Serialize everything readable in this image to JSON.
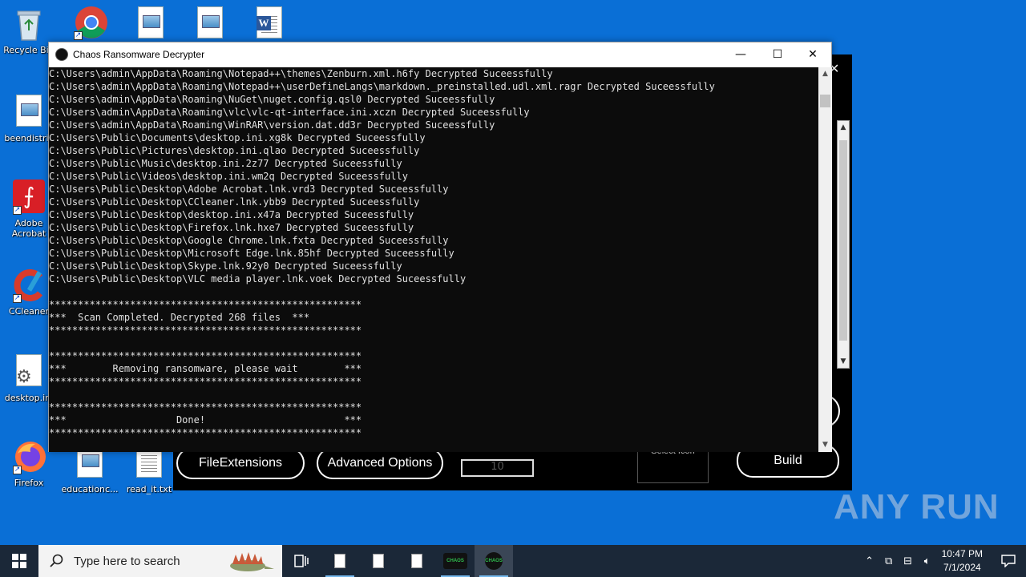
{
  "desktop": {
    "icons": [
      {
        "name": "recycle-bin",
        "label": "Recycle Bin"
      },
      {
        "name": "chrome",
        "label": ""
      },
      {
        "name": "image-file-1",
        "label": ""
      },
      {
        "name": "image-file-2",
        "label": ""
      },
      {
        "name": "word-doc",
        "label": ""
      },
      {
        "name": "beendistrict",
        "label": "beendistric"
      },
      {
        "name": "adobe-acrobat",
        "label": "Adobe Acrobat"
      },
      {
        "name": "ccleaner",
        "label": "CCleaner"
      },
      {
        "name": "desktop-ini",
        "label": "desktop.ini"
      },
      {
        "name": "firefox",
        "label": "Firefox"
      },
      {
        "name": "educationc",
        "label": "educationc..."
      },
      {
        "name": "read-it",
        "label": "read_it.txt"
      }
    ]
  },
  "builder": {
    "file_extensions_label": "FileExtensions",
    "advanced_options_label": "Advanced Options",
    "number_value": "10",
    "select_icon_label": "Select Icon",
    "build_label": "Build",
    "close_glyph": "✕"
  },
  "console_window": {
    "title": "Chaos Ransomware Decrypter",
    "minimize": "—",
    "maximize": "☐",
    "close": "✕",
    "output": "C:\\Users\\admin\\AppData\\Roaming\\Notepad++\\themes\\Zenburn.xml.h6fy Decrypted Suceessfully\nC:\\Users\\admin\\AppData\\Roaming\\Notepad++\\userDefineLangs\\markdown._preinstalled.udl.xml.ragr Decrypted Suceessfully\nC:\\Users\\admin\\AppData\\Roaming\\NuGet\\nuget.config.qsl0 Decrypted Suceessfully\nC:\\Users\\admin\\AppData\\Roaming\\vlc\\vlc-qt-interface.ini.xczn Decrypted Suceessfully\nC:\\Users\\admin\\AppData\\Roaming\\WinRAR\\version.dat.dd3r Decrypted Suceessfully\nC:\\Users\\Public\\Documents\\desktop.ini.xg8k Decrypted Suceessfully\nC:\\Users\\Public\\Pictures\\desktop.ini.qlao Decrypted Suceessfully\nC:\\Users\\Public\\Music\\desktop.ini.2z77 Decrypted Suceessfully\nC:\\Users\\Public\\Videos\\desktop.ini.wm2q Decrypted Suceessfully\nC:\\Users\\Public\\Desktop\\Adobe Acrobat.lnk.vrd3 Decrypted Suceessfully\nC:\\Users\\Public\\Desktop\\CCleaner.lnk.ybb9 Decrypted Suceessfully\nC:\\Users\\Public\\Desktop\\desktop.ini.x47a Decrypted Suceessfully\nC:\\Users\\Public\\Desktop\\Firefox.lnk.hxe7 Decrypted Suceessfully\nC:\\Users\\Public\\Desktop\\Google Chrome.lnk.fxta Decrypted Suceessfully\nC:\\Users\\Public\\Desktop\\Microsoft Edge.lnk.85hf Decrypted Suceessfully\nC:\\Users\\Public\\Desktop\\Skype.lnk.92y0 Decrypted Suceessfully\nC:\\Users\\Public\\Desktop\\VLC media player.lnk.voek Decrypted Suceessfully\n\n******************************************************\n***  Scan Completed. Decrypted 268 files  ***\n******************************************************\n\n******************************************************\n***        Removing ransomware, please wait        ***\n******************************************************\n\n******************************************************\n***                   Done!                        ***\n******************************************************"
  },
  "taskbar": {
    "search_placeholder": "Type here to search",
    "time": "10:47 PM",
    "date": "7/1/2024",
    "apps": [
      "task-view",
      "file-1",
      "file-2",
      "file-3",
      "chaos-builder",
      "chaos-decrypter"
    ],
    "chaos_label": "CHAOS"
  },
  "watermark": "ANY RUN",
  "colors": {
    "desktop": "#0a6fd6",
    "console_bg": "#0c0c0c",
    "console_text": "#e0e0e0",
    "taskbar": "#1b2838"
  }
}
